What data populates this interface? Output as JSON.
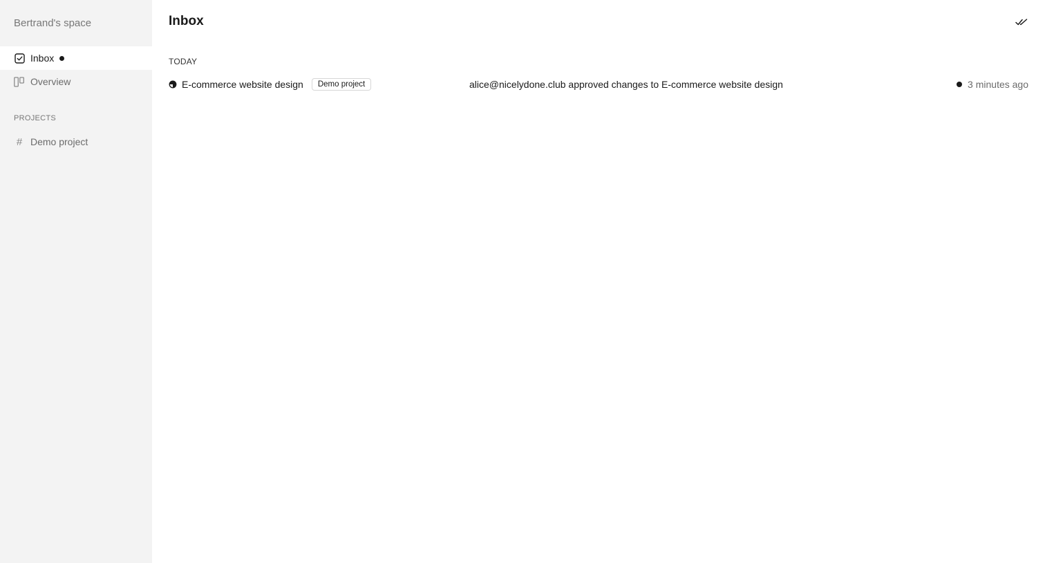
{
  "sidebar": {
    "workspace_name": "Bertrand's space",
    "nav": [
      {
        "label": "Inbox",
        "icon": "checkbox-icon",
        "active": true,
        "unread": true
      },
      {
        "label": "Overview",
        "icon": "board-icon",
        "active": false
      }
    ],
    "projects_label": "PROJECTS",
    "projects": [
      {
        "label": "Demo project",
        "icon": "hash-icon"
      }
    ]
  },
  "main": {
    "title": "Inbox",
    "mark_all_read_icon": "double-check-icon",
    "groups": [
      {
        "label": "TODAY",
        "items": [
          {
            "status_icon": "half-circle-status-icon",
            "task_title": "E-commerce website design",
            "project_tag": "Demo project",
            "activity": "alice@nicelydone.club approved changes to E-commerce website design",
            "time": "3 minutes ago",
            "unread": true
          }
        ]
      }
    ]
  },
  "colors": {
    "sidebar_bg": "#f3f3f3",
    "active_bg": "#ffffff",
    "text": "#1a1a1a",
    "muted": "#6b6b6b"
  }
}
